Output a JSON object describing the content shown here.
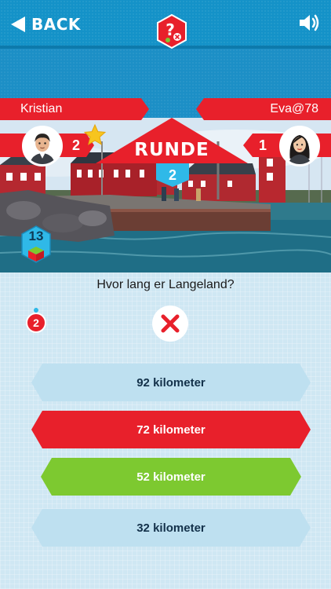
{
  "header": {
    "back_label": "BACK",
    "icons": {
      "back": "back-arrow-icon",
      "sound": "speaker-icon",
      "badge": "question-badge-icon"
    }
  },
  "players": {
    "left": {
      "name": "Kristian",
      "score": "2",
      "has_star": true
    },
    "right": {
      "name": "Eva@78",
      "score": "1"
    }
  },
  "round": {
    "label": "RUNDE",
    "number": "2"
  },
  "question_counter": "13",
  "question": {
    "text": "Hvor lang er Langeland?",
    "wrong_count": "2",
    "result_icon": "wrong-x-icon"
  },
  "answers": [
    {
      "label": "92 kilometer",
      "state": "neutral"
    },
    {
      "label": "72 kilometer",
      "state": "wrong"
    },
    {
      "label": "52 kilometer",
      "state": "correct"
    },
    {
      "label": "32 kilometer",
      "state": "neutral"
    }
  ],
  "colors": {
    "header_blue": "#1492c8",
    "player_red": "#e8202b",
    "correct_green": "#7dc930",
    "neutral_answer": "#bee0f0",
    "round_badge": "#2fb9e8"
  }
}
